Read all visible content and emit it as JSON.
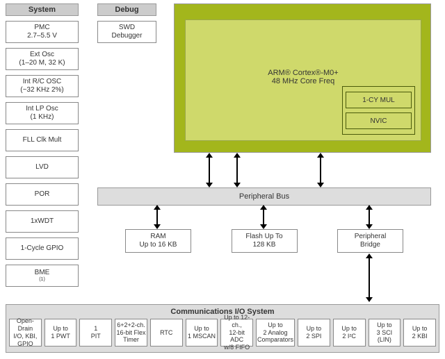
{
  "system": {
    "header": "System",
    "items": [
      "PMC\n2.7–5.5 V",
      "Ext Osc\n(1–20 M, 32 K)",
      "Int R/C OSC\n(~32 KHz 2%)",
      "Int LP Osc\n(1 KHz)",
      "FLL Clk Mult",
      "LVD",
      "POR",
      "1xWDT",
      "1-Cycle GPIO",
      "BME"
    ],
    "bme_sup": "(1)"
  },
  "debug": {
    "header": "Debug",
    "item": "SWD\nDebugger"
  },
  "core": {
    "label_line1": "ARM® Cortex®-M0+",
    "label_line2": "48 MHz Core Freq",
    "sub1": "1-CY MUL",
    "sub2": "NVIC"
  },
  "bus": "Peripheral Bus",
  "mem": {
    "ram": "RAM\nUp to 16 KB",
    "flash": "Flash Up To\n128 KB",
    "bridge": "Peripheral\nBridge"
  },
  "comms": {
    "title": "Communications I/O System",
    "items": [
      "Open-Drain\nI/O, KBI,\nGPIO",
      "Up to\n1 PWT",
      "1\nPIT",
      "6+2+2-ch.\n16-bit Flex\nTimer",
      "RTC",
      "Up to\n1 MSCAN",
      "Up to 12-ch.,\n12-bit ADC\nw/8 FIFO",
      "Up to\n2 Analog\nComparators",
      "Up to\n2 SPI",
      "Up to\n2 I²C",
      "Up to\n3 SCI\n(LIN)",
      "Up to\n2 KBI"
    ]
  }
}
